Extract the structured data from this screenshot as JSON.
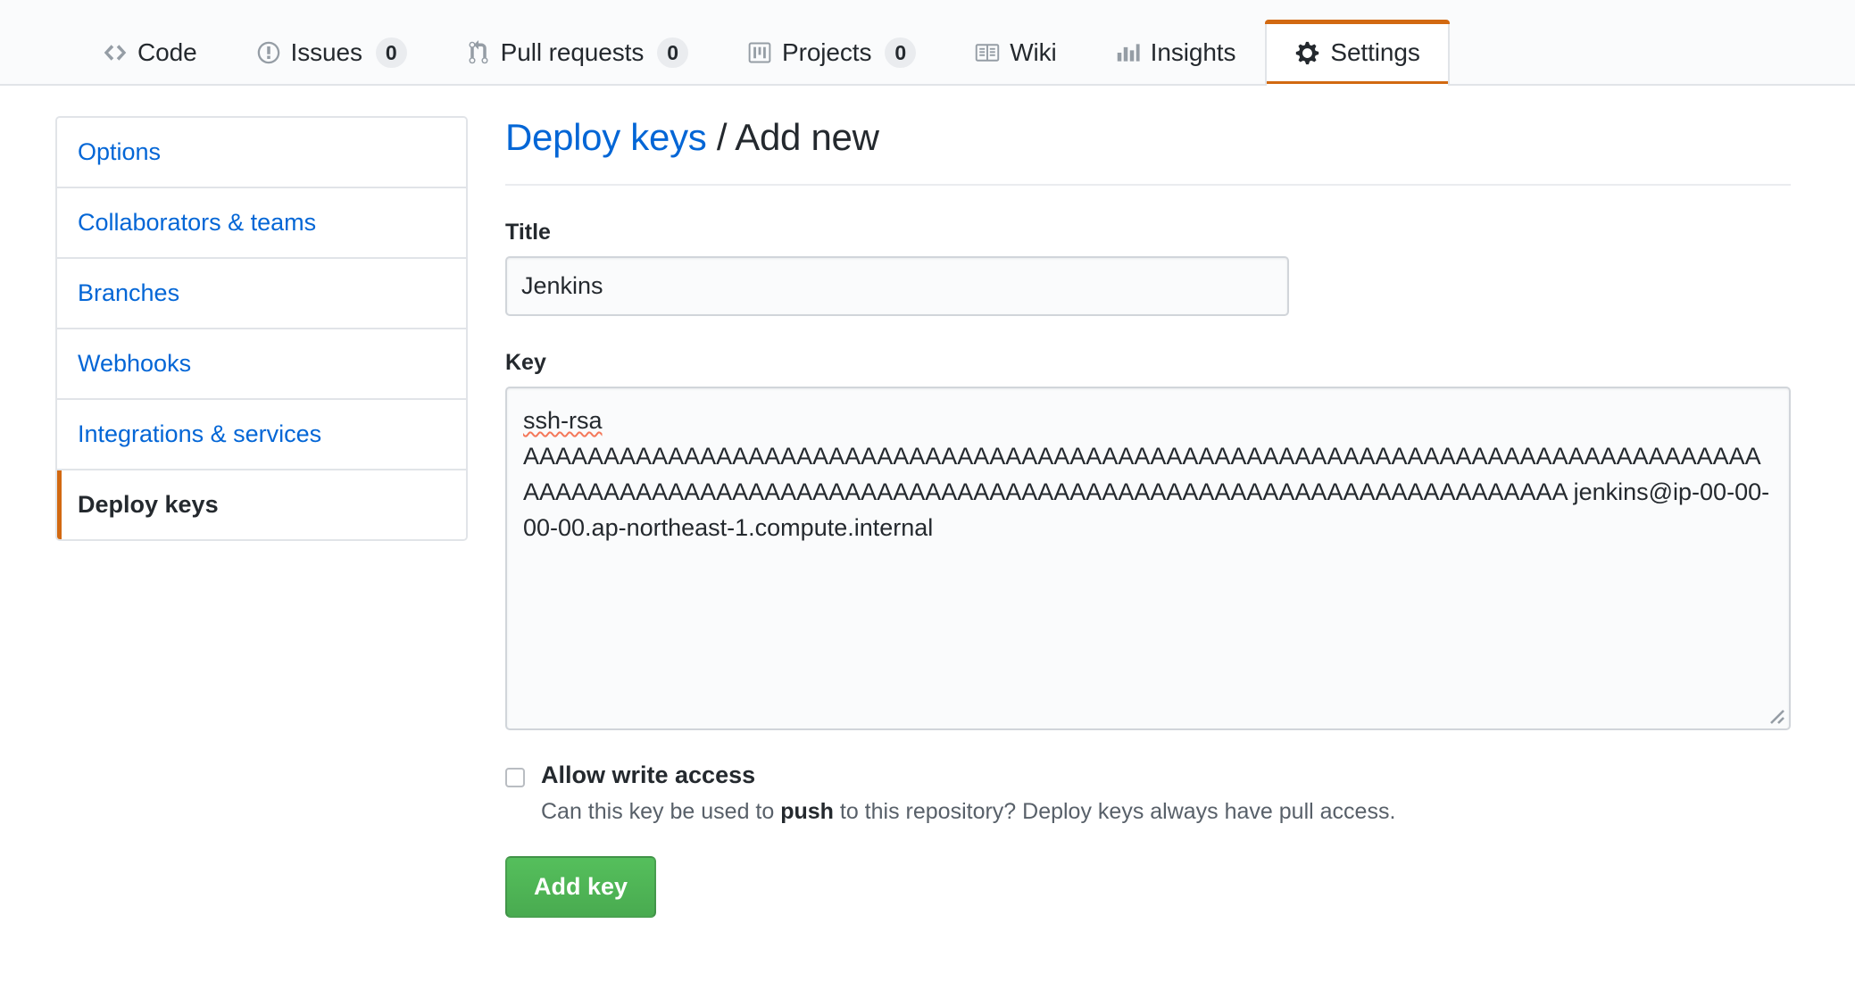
{
  "repo_nav": {
    "tabs": [
      {
        "icon": "code-icon",
        "label": "Code",
        "count": null,
        "selected": false
      },
      {
        "icon": "issue-opened-icon",
        "label": "Issues",
        "count": "0",
        "selected": false
      },
      {
        "icon": "git-pull-request-icon",
        "label": "Pull requests",
        "count": "0",
        "selected": false
      },
      {
        "icon": "project-icon",
        "label": "Projects",
        "count": "0",
        "selected": false
      },
      {
        "icon": "book-icon",
        "label": "Wiki",
        "count": null,
        "selected": false
      },
      {
        "icon": "graph-icon",
        "label": "Insights",
        "count": null,
        "selected": false
      },
      {
        "icon": "gear-icon",
        "label": "Settings",
        "count": null,
        "selected": true
      }
    ]
  },
  "sidebar": {
    "items": [
      {
        "label": "Options",
        "selected": false
      },
      {
        "label": "Collaborators & teams",
        "selected": false
      },
      {
        "label": "Branches",
        "selected": false
      },
      {
        "label": "Webhooks",
        "selected": false
      },
      {
        "label": "Integrations & services",
        "selected": false
      },
      {
        "label": "Deploy keys",
        "selected": true
      }
    ]
  },
  "main": {
    "heading_link": "Deploy keys",
    "heading_separator": " / ",
    "heading_current": "Add new",
    "title_field": {
      "label": "Title",
      "value": "Jenkins",
      "placeholder": ""
    },
    "key_field": {
      "label": "Key",
      "placeholder": "",
      "value_prefix": "ssh-rsa",
      "value_body": "\nAAAAAAAAAAAAAAAAAAAAAAAAAAAAAAAAAAAAAAAAAAAAAAAAAAAAAAAAAAAAAAAAAAAAAAAAAAAAAAAAAAAAAAAAAAAAAAAAAAAAAAAAAAAAAAAAAAAAAAAAAAAAAAAAAAAAAAAAAAAAAA jenkins@ip-00-00-00-00.ap-northeast-1.compute.internal"
    },
    "write_access": {
      "label": "Allow write access",
      "checked": false,
      "note_before": "Can this key be used to ",
      "note_bold": "push",
      "note_after": " to this repository? Deploy keys always have pull access."
    },
    "submit_label": "Add key"
  },
  "colors": {
    "accent_orange": "#d26911",
    "link_blue": "#0366d6",
    "green_button": "#55bf5c",
    "border": "#e1e4e8",
    "nav_bg": "#fafbfc",
    "spellcheck_red": "#f4785a"
  }
}
